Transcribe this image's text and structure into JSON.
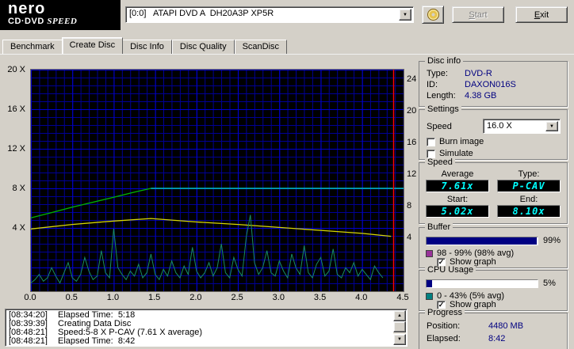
{
  "header": {
    "logo_line1": "nero",
    "logo_line2a": "CD·DVD ",
    "logo_line2b": "SPEED",
    "drive_selector_value": "[0:0]   ATAPI DVD A  DH20A3P XP5R",
    "start_button": "Start",
    "exit_button": "Exit"
  },
  "tabs": [
    {
      "label": "Benchmark",
      "active": false
    },
    {
      "label": "Create Disc",
      "active": true
    },
    {
      "label": "Disc Info",
      "active": false
    },
    {
      "label": "Disc Quality",
      "active": false
    },
    {
      "label": "ScanDisc",
      "active": false
    }
  ],
  "chart_data": {
    "type": "line",
    "x_axis": {
      "min": 0,
      "max": 4.5,
      "ticks": [
        "0.0",
        "0.5",
        "1.0",
        "1.5",
        "2.0",
        "2.5",
        "3.0",
        "3.5",
        "4.0",
        "4.5"
      ]
    },
    "y_axis_left": {
      "ticks": [
        "20 X",
        "16 X",
        "12 X",
        "8 X",
        "4 X"
      ]
    },
    "y_axis_right": {
      "ticks": [
        "24",
        "20",
        "16",
        "12",
        "8",
        "4"
      ]
    },
    "position_marker": {
      "x": 4.38,
      "color": "#ff0000"
    },
    "series": [
      {
        "name": "write-speed-ramp",
        "color": "#00b800",
        "scale": "speed",
        "x": [
          0,
          0.25,
          0.5,
          0.75,
          1.0,
          1.25,
          1.45
        ],
        "y": [
          5.02,
          5.55,
          6.1,
          6.6,
          7.1,
          7.62,
          8.0
        ]
      },
      {
        "name": "write-speed-max",
        "color": "#00e8c8",
        "scale": "speed",
        "x": [
          1.45,
          4.5
        ],
        "y": [
          8.0,
          8.0
        ]
      },
      {
        "name": "rotation-speed",
        "color": "#d8d800",
        "scale": "speed",
        "x": [
          0,
          0.5,
          1.0,
          1.45,
          2.0,
          2.5,
          3.0,
          3.5,
          4.0,
          4.35
        ],
        "y": [
          3.9,
          4.35,
          4.7,
          4.95,
          4.6,
          4.35,
          4.05,
          3.75,
          3.45,
          3.15
        ]
      },
      {
        "name": "cpu-usage",
        "color": "#188c64",
        "scale": "cpu",
        "x_start": 0,
        "x_step": 0.05,
        "values": [
          3,
          5,
          8,
          4,
          6,
          12,
          7,
          3,
          9,
          15,
          6,
          4,
          8,
          18,
          10,
          5,
          7,
          22,
          9,
          6,
          35,
          12,
          8,
          5,
          10,
          7,
          14,
          6,
          9,
          20,
          8,
          5,
          11,
          7,
          16,
          9,
          6,
          13,
          8,
          24,
          10,
          6,
          9,
          15,
          7,
          12,
          26,
          9,
          6,
          18,
          11,
          7,
          30,
          43,
          15,
          8,
          12,
          22,
          9,
          7,
          16,
          10,
          6,
          20,
          12,
          8,
          25,
          9,
          6,
          14,
          18,
          7,
          10,
          23,
          8,
          6,
          12,
          9,
          15,
          7,
          11,
          8,
          5,
          13,
          9,
          6
        ]
      }
    ]
  },
  "disc_info": {
    "title": "Disc info",
    "rows": [
      {
        "label": "Type:",
        "value": "DVD-R"
      },
      {
        "label": "ID:",
        "value": "DAXON016S"
      },
      {
        "label": "Length:",
        "value": "4.38 GB"
      }
    ]
  },
  "settings": {
    "title": "Settings",
    "speed_label": "Speed",
    "speed_value": "16.0 X",
    "checkboxes": [
      {
        "label": "Burn image",
        "checked": false
      },
      {
        "label": "Simulate",
        "checked": false
      }
    ]
  },
  "speed_panel": {
    "title": "Speed",
    "cells": [
      {
        "label": "Average",
        "value": "7.61x"
      },
      {
        "label": "Type:",
        "value": "P-CAV"
      },
      {
        "label": "Start:",
        "value": "5.02x"
      },
      {
        "label": "End:",
        "value": "8.10x"
      }
    ]
  },
  "buffer": {
    "title": "Buffer",
    "percent_label": "99%",
    "fill_percent": 99,
    "swatch_color": "#993399",
    "range_text": "98 - 99% (98% avg)",
    "show_graph_label": "Show graph",
    "show_graph_checked": true
  },
  "cpu": {
    "title": "CPU Usage",
    "percent_label": "5%",
    "fill_percent": 5,
    "swatch_color": "#008080",
    "range_text": "0 - 43% (5% avg)",
    "show_graph_label": "Show graph",
    "show_graph_checked": true
  },
  "progress": {
    "title": "Progress",
    "rows": [
      {
        "label": "Position:",
        "value": "4480 MB"
      },
      {
        "label": "Elapsed:",
        "value": "8:42"
      }
    ]
  },
  "log": {
    "lines": [
      {
        "time": "[08:34:20]",
        "text": "Elapsed Time:  5:18"
      },
      {
        "time": "[08:39:39]",
        "text": "Creating Data Disc"
      },
      {
        "time": "[08:48:21]",
        "text": "Speed:5-8 X P-CAV (7.61 X average)"
      },
      {
        "time": "[08:48:21]",
        "text": "Elapsed Time:  8:42"
      }
    ]
  },
  "colors": {
    "value_text": "#000080",
    "lcd_text": "#00ffff",
    "lcd_bg": "#000000",
    "bar_fill": "#000082",
    "chart_bg": "#000000",
    "grid_minor": "#000096",
    "grid_major": "#0000d2"
  }
}
